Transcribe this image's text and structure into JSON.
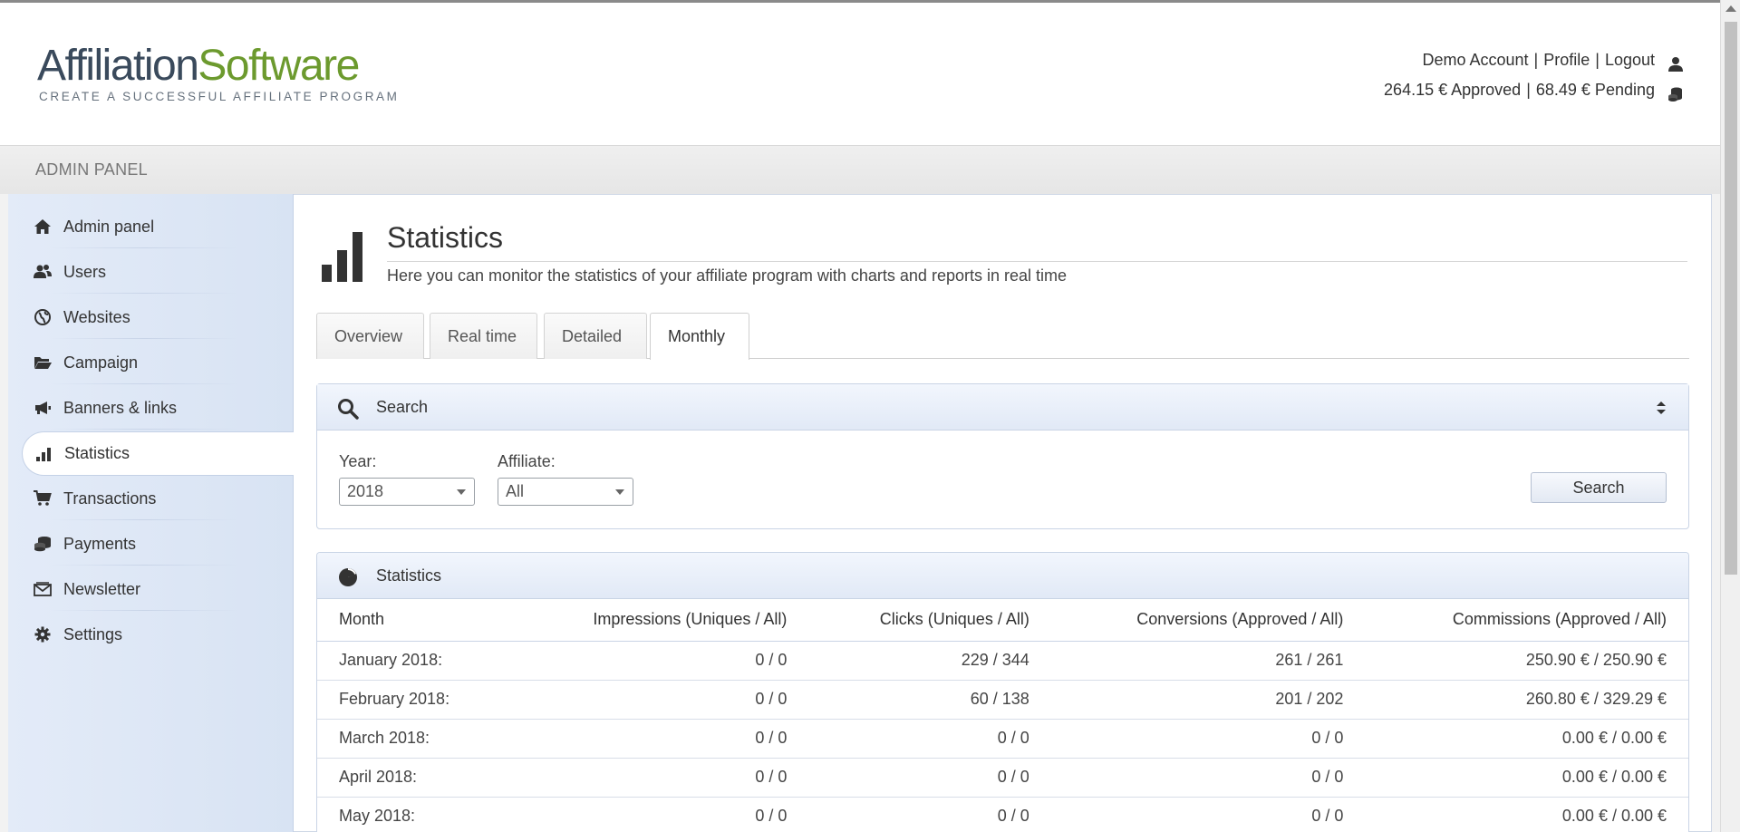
{
  "brand": {
    "name_part1": "Affiliation",
    "name_part2": "Software",
    "tagline": "CREATE A SUCCESSFUL AFFILIATE PROGRAM"
  },
  "account": {
    "name": "Demo Account",
    "profile": "Profile",
    "logout": "Logout",
    "approved": "264.15 € Approved",
    "pending": "68.49 € Pending",
    "separator": "|"
  },
  "panel_label": "ADMIN PANEL",
  "sidebar": {
    "items": [
      {
        "label": "Admin panel",
        "icon": "home-icon"
      },
      {
        "label": "Users",
        "icon": "users-icon"
      },
      {
        "label": "Websites",
        "icon": "globe-icon"
      },
      {
        "label": "Campaign",
        "icon": "folder-icon"
      },
      {
        "label": "Banners & links",
        "icon": "megaphone-icon"
      },
      {
        "label": "Statistics",
        "icon": "bar-chart-icon",
        "active": true
      },
      {
        "label": "Transactions",
        "icon": "cart-icon"
      },
      {
        "label": "Payments",
        "icon": "coins-icon"
      },
      {
        "label": "Newsletter",
        "icon": "envelope-icon"
      },
      {
        "label": "Settings",
        "icon": "gear-icon"
      }
    ]
  },
  "page": {
    "title": "Statistics",
    "subtitle": "Here you can monitor the statistics of your affiliate program with charts and reports in real time"
  },
  "tabs": [
    {
      "label": "Overview"
    },
    {
      "label": "Real time"
    },
    {
      "label": "Detailed"
    },
    {
      "label": "Monthly",
      "active": true
    }
  ],
  "search_box": {
    "title": "Search",
    "year_label": "Year:",
    "year_value": "2018",
    "affiliate_label": "Affiliate:",
    "affiliate_value": "All",
    "button": "Search"
  },
  "stats_box": {
    "title": "Statistics",
    "columns": [
      "Month",
      "Impressions (Uniques / All)",
      "Clicks (Uniques / All)",
      "Conversions (Approved / All)",
      "Commissions (Approved / All)"
    ],
    "rows": [
      [
        "January 2018:",
        "0 / 0",
        "229 / 344",
        "261 / 261",
        "250.90 € / 250.90 €"
      ],
      [
        "February 2018:",
        "0 / 0",
        "60 / 138",
        "201 / 202",
        "260.80 € / 329.29 €"
      ],
      [
        "March 2018:",
        "0 / 0",
        "0 / 0",
        "0 / 0",
        "0.00 € / 0.00 €"
      ],
      [
        "April 2018:",
        "0 / 0",
        "0 / 0",
        "0 / 0",
        "0.00 € / 0.00 €"
      ],
      [
        "May 2018:",
        "0 / 0",
        "0 / 0",
        "0 / 0",
        "0.00 € / 0.00 €"
      ]
    ]
  },
  "colors": {
    "brand_dark": "#3a4a5c",
    "brand_green": "#6c9a2e",
    "sidebar_bg": "#dce6f5"
  }
}
